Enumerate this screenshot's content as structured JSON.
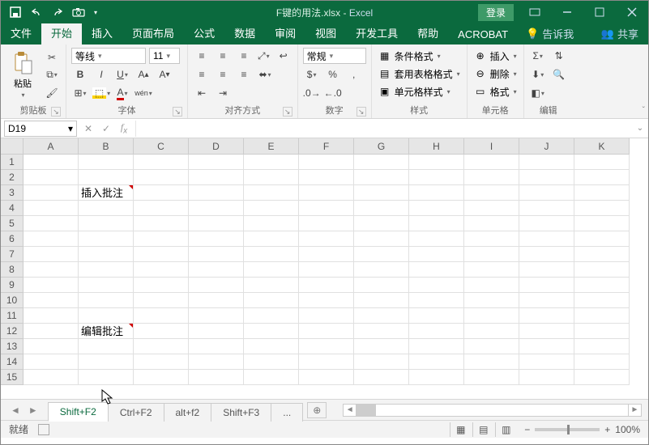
{
  "titlebar": {
    "filename": "F键的用法.xlsx",
    "app": "Excel",
    "login": "登录"
  },
  "tabs": {
    "items": [
      "文件",
      "开始",
      "插入",
      "页面布局",
      "公式",
      "数据",
      "审阅",
      "视图",
      "开发工具",
      "帮助",
      "ACROBAT"
    ],
    "active": 1,
    "tellme": "告诉我",
    "share": "共享"
  },
  "ribbon": {
    "clipboard": {
      "label": "剪贴板",
      "paste": "粘贴"
    },
    "font": {
      "label": "字体",
      "name": "等线",
      "size": "11"
    },
    "align": {
      "label": "对齐方式"
    },
    "number": {
      "label": "数字",
      "format": "常规"
    },
    "styles": {
      "label": "样式",
      "cond": "条件格式",
      "table": "套用表格格式",
      "cell": "单元格样式"
    },
    "cells": {
      "label": "单元格",
      "insert": "插入",
      "delete": "删除",
      "format": "格式"
    },
    "editing": {
      "label": "编辑"
    }
  },
  "namebox": "D19",
  "columns": [
    "A",
    "B",
    "C",
    "D",
    "E",
    "F",
    "G",
    "H",
    "I",
    "J",
    "K"
  ],
  "rows": [
    "1",
    "2",
    "3",
    "4",
    "5",
    "6",
    "7",
    "8",
    "9",
    "10",
    "11",
    "12",
    "13",
    "14",
    "15"
  ],
  "cells": {
    "B3": "插入批注",
    "B12": "编辑批注"
  },
  "comments": [
    "B3",
    "B12"
  ],
  "sheets": {
    "items": [
      "Shift+F2",
      "Ctrl+F2",
      "alt+f2",
      "Shift+F3"
    ],
    "active": 0,
    "more": "..."
  },
  "status": {
    "ready": "就绪",
    "zoom": "100%"
  }
}
